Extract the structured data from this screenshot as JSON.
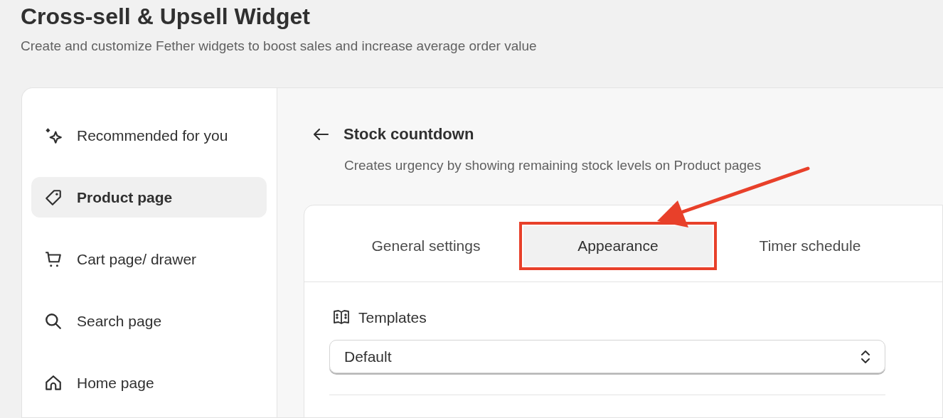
{
  "header": {
    "title": "Cross-sell & Upsell Widget",
    "subtitle": "Create and customize Fether widgets to boost sales and increase average order value"
  },
  "sidebar": {
    "items": [
      {
        "kind": "sparkle",
        "label": "Recommended for you",
        "selected": false
      },
      {
        "kind": "tag",
        "label": "Product page",
        "selected": true
      },
      {
        "kind": "cart",
        "label": "Cart page/ drawer",
        "selected": false
      },
      {
        "kind": "search",
        "label": "Search page",
        "selected": false
      },
      {
        "kind": "home",
        "label": "Home page",
        "selected": false
      }
    ]
  },
  "widget": {
    "title": "Stock countdown",
    "description": "Creates urgency by showing remaining stock levels on Product pages"
  },
  "tabs": [
    {
      "label": "General settings",
      "selected": false,
      "annotated": false
    },
    {
      "label": "Appearance",
      "selected": true,
      "annotated": true
    },
    {
      "label": "Timer schedule",
      "selected": false,
      "annotated": false
    }
  ],
  "templates": {
    "label": "Templates",
    "value": "Default"
  }
}
